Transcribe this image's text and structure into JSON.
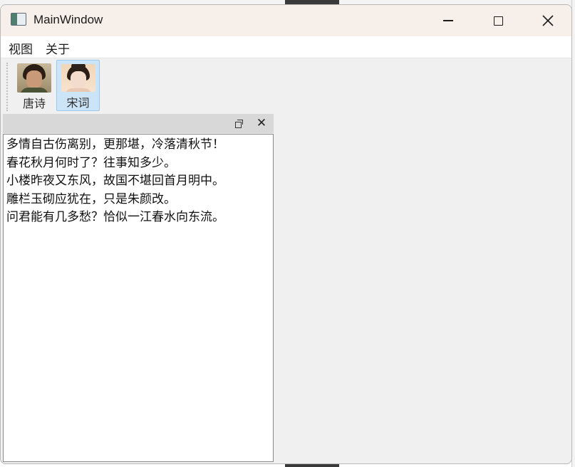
{
  "window": {
    "title": "MainWindow",
    "controls": {
      "minimize": "minimize",
      "maximize": "maximize",
      "close": "✕"
    }
  },
  "menubar": {
    "items": [
      {
        "label": "视图"
      },
      {
        "label": "关于"
      }
    ]
  },
  "toolbar": {
    "buttons": [
      {
        "label": "唐诗",
        "icon": "tang-poet-portrait-icon",
        "selected": false
      },
      {
        "label": "宋词",
        "icon": "song-poet-portrait-icon",
        "selected": true
      }
    ]
  },
  "dock": {
    "title": "",
    "float_icon": "float-icon",
    "close_label": "✕",
    "lines": [
      "多情自古伤离别，更那堪，冷落清秋节！",
      "春花秋月何时了？往事知多少。",
      "小楼昨夜又东风，故国不堪回首月明中。",
      "雕栏玉砌应犹在，只是朱颜改。",
      "问君能有几多愁？恰似一江春水向东流。"
    ]
  },
  "colors": {
    "titlebar": "#f7efe9",
    "selected_tool": "#cce4f7",
    "dock_title": "#d8d8d8"
  }
}
